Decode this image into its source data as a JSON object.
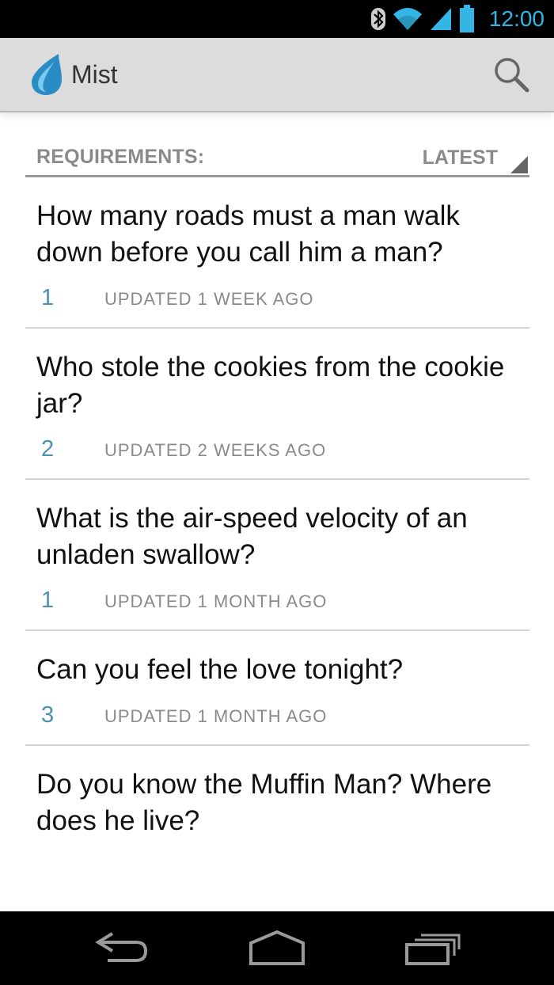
{
  "status_bar": {
    "time": "12:00",
    "accent_color": "#33b5e5",
    "icons": [
      "bluetooth-icon",
      "wifi-icon",
      "signal-icon",
      "battery-icon"
    ]
  },
  "action_bar": {
    "title": "Mist",
    "logo_icon": "water-drop-icon",
    "search_icon": "search-icon"
  },
  "section": {
    "label": "REQUIREMENTS:",
    "sort_value": "LATEST"
  },
  "items": [
    {
      "question": "How many roads must a man walk down before you call him a man?",
      "count": "1",
      "updated": "UPDATED 1 WEEK AGO"
    },
    {
      "question": "Who stole the cookies from the cookie jar?",
      "count": "2",
      "updated": "UPDATED 2 WEEKS AGO"
    },
    {
      "question": "What is the air-speed velocity of an unladen swallow?",
      "count": "1",
      "updated": "UPDATED 1 MONTH AGO"
    },
    {
      "question": "Can you feel the love tonight?",
      "count": "3",
      "updated": "UPDATED 1 MONTH AGO"
    },
    {
      "question": "Do you know the Muffin Man? Where does he live?",
      "count": "",
      "updated": ""
    }
  ],
  "nav_bar": {
    "buttons": [
      "back-icon",
      "home-icon",
      "recents-icon"
    ]
  },
  "colors": {
    "count_text": "#4f8fb4",
    "action_bar_bg": "#dcdcdc"
  }
}
